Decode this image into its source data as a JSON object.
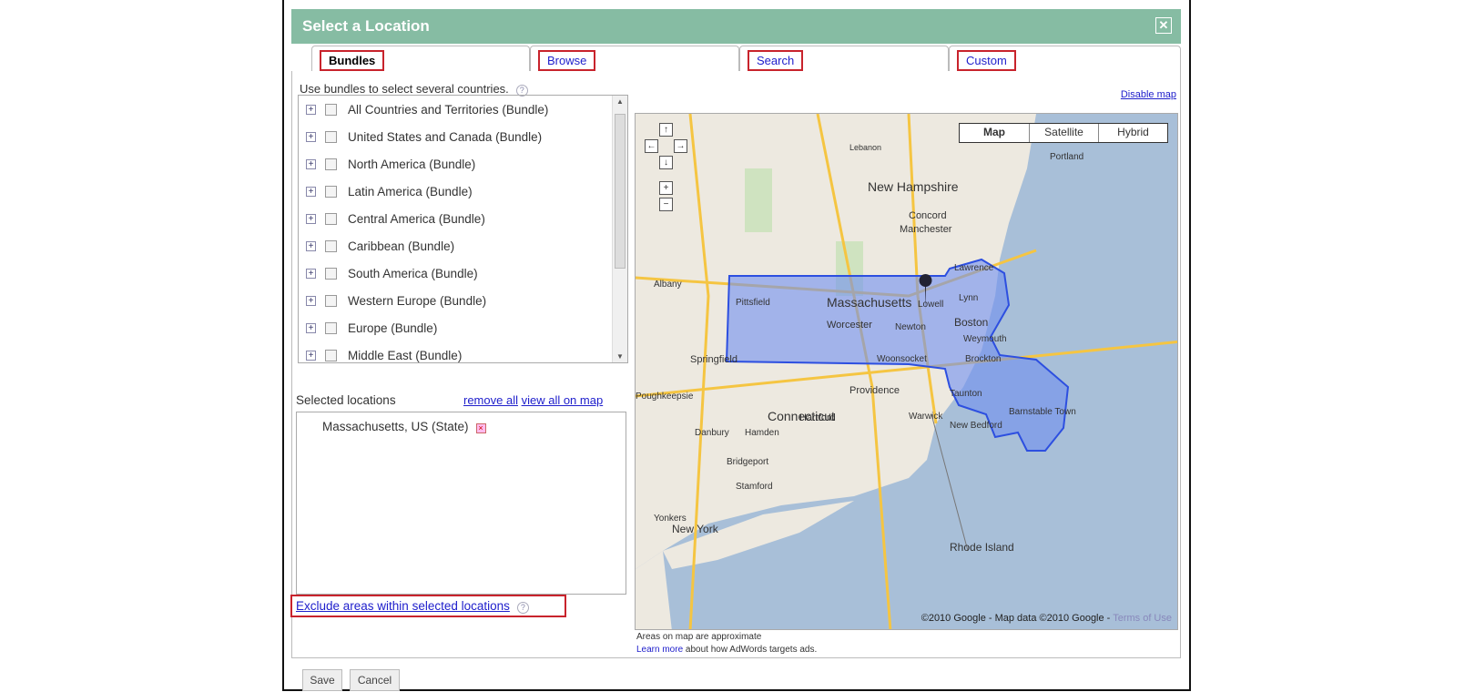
{
  "dialog": {
    "title": "Select a Location",
    "close_icon": "close-icon"
  },
  "tabs": [
    {
      "label": "Bundles",
      "active": true
    },
    {
      "label": "Browse"
    },
    {
      "label": "Search"
    },
    {
      "label": "Custom"
    }
  ],
  "bundles": {
    "hint": "Use bundles to select several countries.",
    "items": [
      "All Countries and Territories (Bundle)",
      "United States and Canada (Bundle)",
      "North America (Bundle)",
      "Latin America (Bundle)",
      "Central America (Bundle)",
      "Caribbean (Bundle)",
      "South America (Bundle)",
      "Western Europe (Bundle)",
      "Europe (Bundle)",
      "Middle East (Bundle)"
    ]
  },
  "selected": {
    "label": "Selected locations",
    "remove_all": "remove all",
    "view_all": "view all on map",
    "items": [
      "Massachusetts, US (State)"
    ]
  },
  "exclude_link": "Exclude areas within selected locations",
  "map": {
    "disable_link": "Disable map",
    "types": [
      "Map",
      "Satellite",
      "Hybrid"
    ],
    "active_type": "Map",
    "labels": [
      "New Hampshire",
      "Concord",
      "Manchester",
      "Massachusetts",
      "Worcester",
      "Newton",
      "Boston",
      "Lowell",
      "Lawrence",
      "Lynn",
      "Weymouth",
      "Brockton",
      "Woonsocket",
      "Springfield",
      "Pittsfield",
      "Albany",
      "Hartford",
      "Providence",
      "Taunton",
      "Warwick",
      "Connecticut",
      "New Bedford",
      "Barnstable Town",
      "Danbury",
      "Hamden",
      "Bridgeport",
      "Stamford",
      "Poughkeepsie",
      "Yonkers",
      "New York",
      "Rhode Island",
      "Portland",
      "Lebanon"
    ],
    "copyright": "©2010 Google - Map data ©2010 Google -",
    "terms": "Terms of Use",
    "colors": {
      "water": "#a8bfd8",
      "land": "#ede9e0",
      "highlight": "#6f8ff0"
    }
  },
  "notes": {
    "approx": "Areas on map are approximate",
    "learn_more": "Learn more",
    "learn_rest": " about how AdWords targets ads."
  },
  "buttons": {
    "save": "Save",
    "cancel": "Cancel"
  }
}
